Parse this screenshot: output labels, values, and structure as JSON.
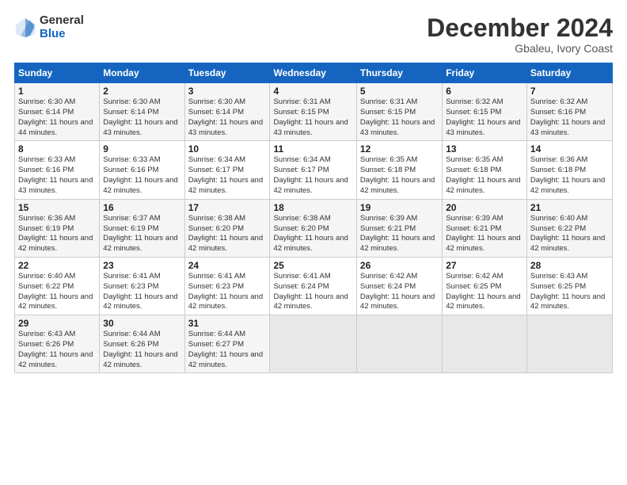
{
  "logo": {
    "general": "General",
    "blue": "Blue"
  },
  "header": {
    "month": "December 2024",
    "location": "Gbaleu, Ivory Coast"
  },
  "weekdays": [
    "Sunday",
    "Monday",
    "Tuesday",
    "Wednesday",
    "Thursday",
    "Friday",
    "Saturday"
  ],
  "weeks": [
    [
      {
        "day": "1",
        "sunrise": "6:30 AM",
        "sunset": "6:14 PM",
        "daylight": "11 hours and 44 minutes."
      },
      {
        "day": "2",
        "sunrise": "6:30 AM",
        "sunset": "6:14 PM",
        "daylight": "11 hours and 43 minutes."
      },
      {
        "day": "3",
        "sunrise": "6:30 AM",
        "sunset": "6:14 PM",
        "daylight": "11 hours and 43 minutes."
      },
      {
        "day": "4",
        "sunrise": "6:31 AM",
        "sunset": "6:15 PM",
        "daylight": "11 hours and 43 minutes."
      },
      {
        "day": "5",
        "sunrise": "6:31 AM",
        "sunset": "6:15 PM",
        "daylight": "11 hours and 43 minutes."
      },
      {
        "day": "6",
        "sunrise": "6:32 AM",
        "sunset": "6:15 PM",
        "daylight": "11 hours and 43 minutes."
      },
      {
        "day": "7",
        "sunrise": "6:32 AM",
        "sunset": "6:16 PM",
        "daylight": "11 hours and 43 minutes."
      }
    ],
    [
      {
        "day": "8",
        "sunrise": "6:33 AM",
        "sunset": "6:16 PM",
        "daylight": "11 hours and 43 minutes."
      },
      {
        "day": "9",
        "sunrise": "6:33 AM",
        "sunset": "6:16 PM",
        "daylight": "11 hours and 42 minutes."
      },
      {
        "day": "10",
        "sunrise": "6:34 AM",
        "sunset": "6:17 PM",
        "daylight": "11 hours and 42 minutes."
      },
      {
        "day": "11",
        "sunrise": "6:34 AM",
        "sunset": "6:17 PM",
        "daylight": "11 hours and 42 minutes."
      },
      {
        "day": "12",
        "sunrise": "6:35 AM",
        "sunset": "6:18 PM",
        "daylight": "11 hours and 42 minutes."
      },
      {
        "day": "13",
        "sunrise": "6:35 AM",
        "sunset": "6:18 PM",
        "daylight": "11 hours and 42 minutes."
      },
      {
        "day": "14",
        "sunrise": "6:36 AM",
        "sunset": "6:18 PM",
        "daylight": "11 hours and 42 minutes."
      }
    ],
    [
      {
        "day": "15",
        "sunrise": "6:36 AM",
        "sunset": "6:19 PM",
        "daylight": "11 hours and 42 minutes."
      },
      {
        "day": "16",
        "sunrise": "6:37 AM",
        "sunset": "6:19 PM",
        "daylight": "11 hours and 42 minutes."
      },
      {
        "day": "17",
        "sunrise": "6:38 AM",
        "sunset": "6:20 PM",
        "daylight": "11 hours and 42 minutes."
      },
      {
        "day": "18",
        "sunrise": "6:38 AM",
        "sunset": "6:20 PM",
        "daylight": "11 hours and 42 minutes."
      },
      {
        "day": "19",
        "sunrise": "6:39 AM",
        "sunset": "6:21 PM",
        "daylight": "11 hours and 42 minutes."
      },
      {
        "day": "20",
        "sunrise": "6:39 AM",
        "sunset": "6:21 PM",
        "daylight": "11 hours and 42 minutes."
      },
      {
        "day": "21",
        "sunrise": "6:40 AM",
        "sunset": "6:22 PM",
        "daylight": "11 hours and 42 minutes."
      }
    ],
    [
      {
        "day": "22",
        "sunrise": "6:40 AM",
        "sunset": "6:22 PM",
        "daylight": "11 hours and 42 minutes."
      },
      {
        "day": "23",
        "sunrise": "6:41 AM",
        "sunset": "6:23 PM",
        "daylight": "11 hours and 42 minutes."
      },
      {
        "day": "24",
        "sunrise": "6:41 AM",
        "sunset": "6:23 PM",
        "daylight": "11 hours and 42 minutes."
      },
      {
        "day": "25",
        "sunrise": "6:41 AM",
        "sunset": "6:24 PM",
        "daylight": "11 hours and 42 minutes."
      },
      {
        "day": "26",
        "sunrise": "6:42 AM",
        "sunset": "6:24 PM",
        "daylight": "11 hours and 42 minutes."
      },
      {
        "day": "27",
        "sunrise": "6:42 AM",
        "sunset": "6:25 PM",
        "daylight": "11 hours and 42 minutes."
      },
      {
        "day": "28",
        "sunrise": "6:43 AM",
        "sunset": "6:25 PM",
        "daylight": "11 hours and 42 minutes."
      }
    ],
    [
      {
        "day": "29",
        "sunrise": "6:43 AM",
        "sunset": "6:26 PM",
        "daylight": "11 hours and 42 minutes."
      },
      {
        "day": "30",
        "sunrise": "6:44 AM",
        "sunset": "6:26 PM",
        "daylight": "11 hours and 42 minutes."
      },
      {
        "day": "31",
        "sunrise": "6:44 AM",
        "sunset": "6:27 PM",
        "daylight": "11 hours and 42 minutes."
      },
      null,
      null,
      null,
      null
    ]
  ]
}
